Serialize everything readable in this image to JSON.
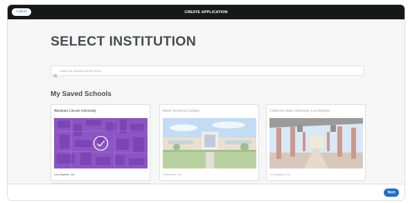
{
  "header": {
    "cancel_label": "Cancel",
    "title": "CREATE APPLICATION"
  },
  "page": {
    "title": "SELECT INSTITUTION"
  },
  "search": {
    "placeholder": "Search for schools and the NCAA"
  },
  "saved_schools": {
    "title": "My Saved Schools",
    "cards": [
      {
        "name": "Abraham Lincoln University",
        "location": "Los Angeles, CA",
        "selected": true,
        "image": "campus-aerial-map"
      },
      {
        "name": "Aiken Technical College",
        "location": "Graniteville, SC",
        "selected": false,
        "image": "college-building-photo"
      },
      {
        "name": "California State University, Los Angeles",
        "location": "Los Angeles, CA",
        "selected": false,
        "image": "campus-walkway-photo"
      }
    ]
  },
  "footer": {
    "next_label": "Next"
  },
  "colors": {
    "topbar": "#17181a",
    "accent": "#1f6fc8",
    "selected_overlay": "#8a4fc0"
  }
}
